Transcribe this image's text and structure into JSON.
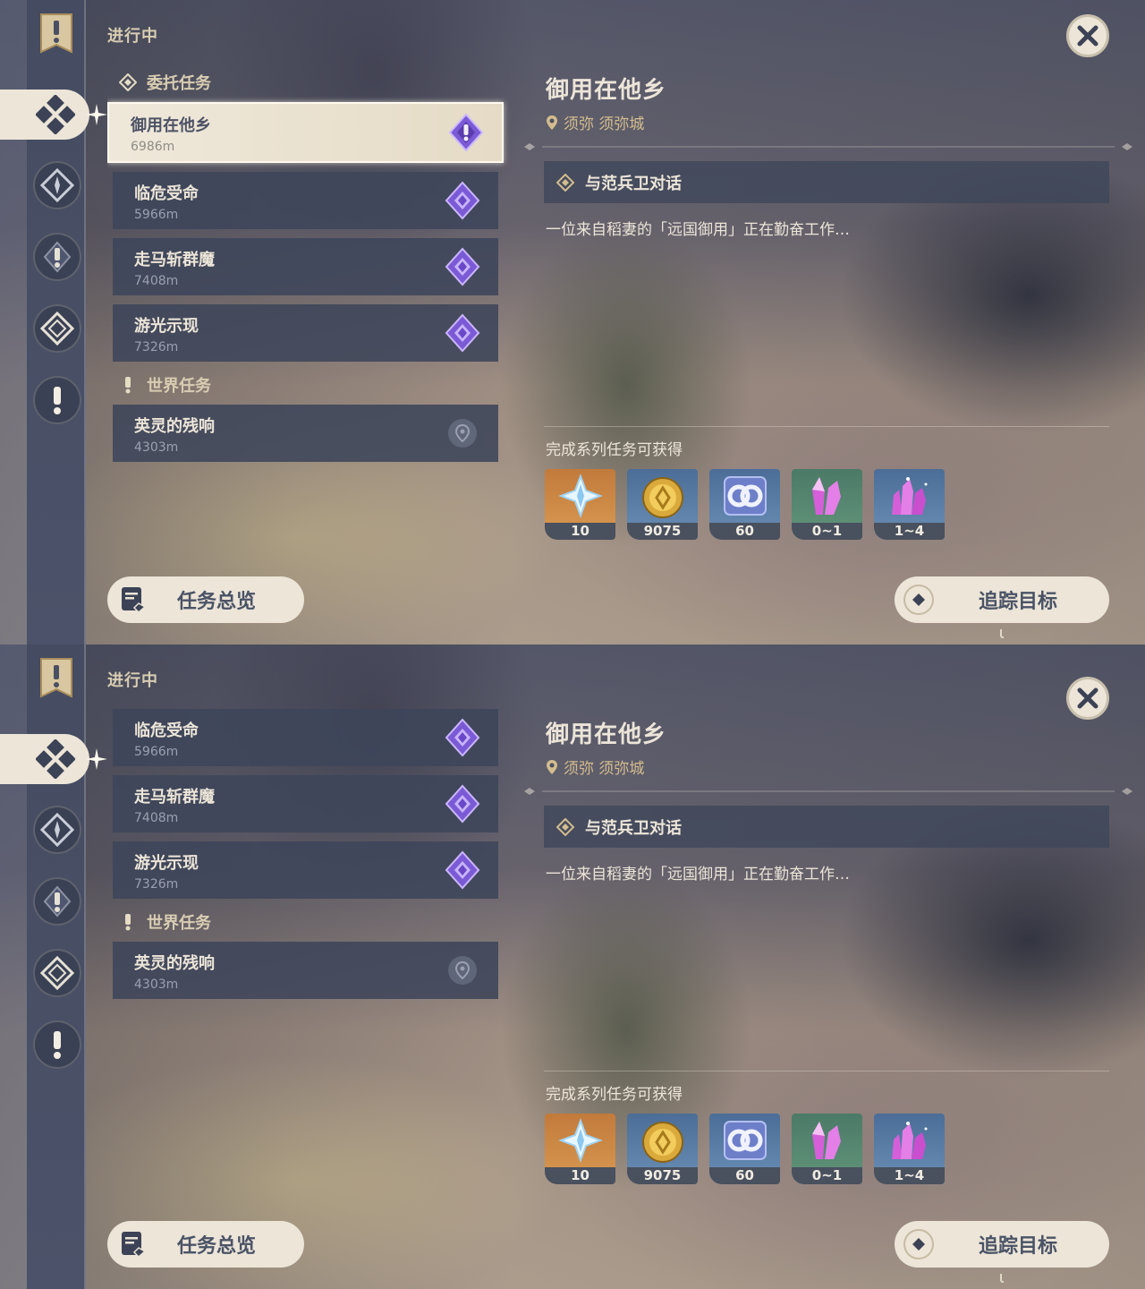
{
  "header": {
    "status": "进行中"
  },
  "categories": {
    "commission": {
      "label": "委托任务"
    },
    "world": {
      "label": "世界任务"
    }
  },
  "quests": [
    {
      "title": "御用在他乡",
      "distance": "6986m",
      "type": "commission",
      "selected": true
    },
    {
      "title": "临危受命",
      "distance": "5966m",
      "type": "commission"
    },
    {
      "title": "走马斩群魔",
      "distance": "7408m",
      "type": "commission"
    },
    {
      "title": "游光示现",
      "distance": "7326m",
      "type": "commission"
    },
    {
      "title": "英灵的残响",
      "distance": "4303m",
      "type": "world"
    }
  ],
  "detail": {
    "title": "御用在他乡",
    "location": "须弥 须弥城",
    "objective": "与范兵卫对话",
    "description": "一位来自稻妻的「远国御用」正在勤奋工作…",
    "rewards_label": "完成系列任务可获得",
    "rewards": [
      {
        "icon": "primogem-icon",
        "count": "10",
        "bg": "orange"
      },
      {
        "icon": "mora-icon",
        "count": "9075",
        "bg": "blue"
      },
      {
        "icon": "friendship-icon",
        "count": "60",
        "bg": "blue"
      },
      {
        "icon": "crystal-chunk-icon",
        "count": "0~1",
        "bg": "green"
      },
      {
        "icon": "crystal-cluster-icon",
        "count": "1~4",
        "bg": "blue"
      }
    ]
  },
  "buttons": {
    "overview": "任务总览",
    "track": "追踪目标"
  },
  "colors": {
    "accent_gold": "#d3bc8e",
    "cream": "#ece5d8",
    "slate": "#3e465a",
    "purple": "#7b5ad6"
  },
  "list_scroll": {
    "first_view": 0,
    "second_view": 0.55
  }
}
